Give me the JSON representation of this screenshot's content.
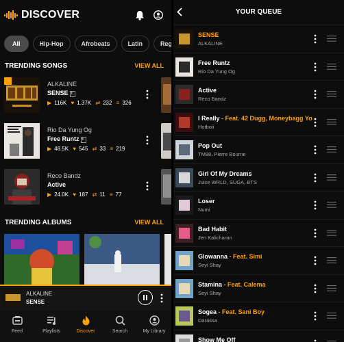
{
  "discover": {
    "title": "DISCOVER",
    "chips": [
      "All",
      "Hip-Hop",
      "Afrobeats",
      "Latin",
      "Regga"
    ],
    "trending_songs": {
      "title": "TRENDING SONGS",
      "view_all": "VIEW ALL",
      "items": [
        {
          "artist": "ALKALINE",
          "title": "SENSE",
          "explicit": "E",
          "plays": "116K",
          "likes": "1.37K",
          "reposts": "232",
          "playlists": "326"
        },
        {
          "artist": "Rio Da Yung Og",
          "title": "Free Runtz",
          "explicit": "E",
          "plays": "48.5K",
          "likes": "545",
          "reposts": "33",
          "playlists": "219"
        },
        {
          "artist": "Reco Bandz",
          "title": "Active",
          "explicit": "",
          "plays": "24.0K",
          "likes": "187",
          "reposts": "11",
          "playlists": "77"
        }
      ]
    },
    "trending_albums": {
      "title": "TRENDING ALBUMS",
      "view_all": "VIEW ALL"
    },
    "now_playing": {
      "artist": "ALKALINE",
      "title": "SENSE"
    },
    "tabs": [
      {
        "label": "Feed",
        "icon": "feed-icon"
      },
      {
        "label": "Playlists",
        "icon": "playlists-icon"
      },
      {
        "label": "Discover",
        "icon": "flame-icon"
      },
      {
        "label": "Search",
        "icon": "search-icon"
      },
      {
        "label": "My Library",
        "icon": "library-icon"
      }
    ],
    "active_tab": "Discover"
  },
  "queue": {
    "title": "YOUR QUEUE",
    "items": [
      {
        "title": "SENSE",
        "feat": "",
        "artist": "ALKALINE",
        "current": true
      },
      {
        "title": "Free Runtz",
        "feat": "",
        "artist": "Rio Da Yung Og"
      },
      {
        "title": "Active",
        "feat": "",
        "artist": "Reco Bandz"
      },
      {
        "title": "I Really",
        "feat": " - Feat. 42 Dugg, Moneybagg Yo",
        "artist": "Hotboii"
      },
      {
        "title": "Pop Out",
        "feat": "",
        "artist": "TM88, Pierre Bourne"
      },
      {
        "title": "Girl Of My Dreams",
        "feat": "",
        "artist": "Juice WRLD, SUGA, BTS"
      },
      {
        "title": "Loser",
        "feat": "",
        "artist": "Numi"
      },
      {
        "title": "Bad Habit",
        "feat": "",
        "artist": "Jen Kalicharan"
      },
      {
        "title": "Glowanna",
        "feat": " - Feat. Simi",
        "artist": "Seyi Shay"
      },
      {
        "title": "Stamina",
        "feat": " - Feat. Calema",
        "artist": "Seyi Shay"
      },
      {
        "title": "Sogea",
        "feat": " - Feat. Sani Boy",
        "artist": "Darassa"
      },
      {
        "title": "Show Me Off",
        "feat": "",
        "artist": ""
      }
    ]
  },
  "colors": {
    "accent": "#ffa200",
    "background": "#0d0d0d",
    "divider": "#1d1d1d"
  }
}
